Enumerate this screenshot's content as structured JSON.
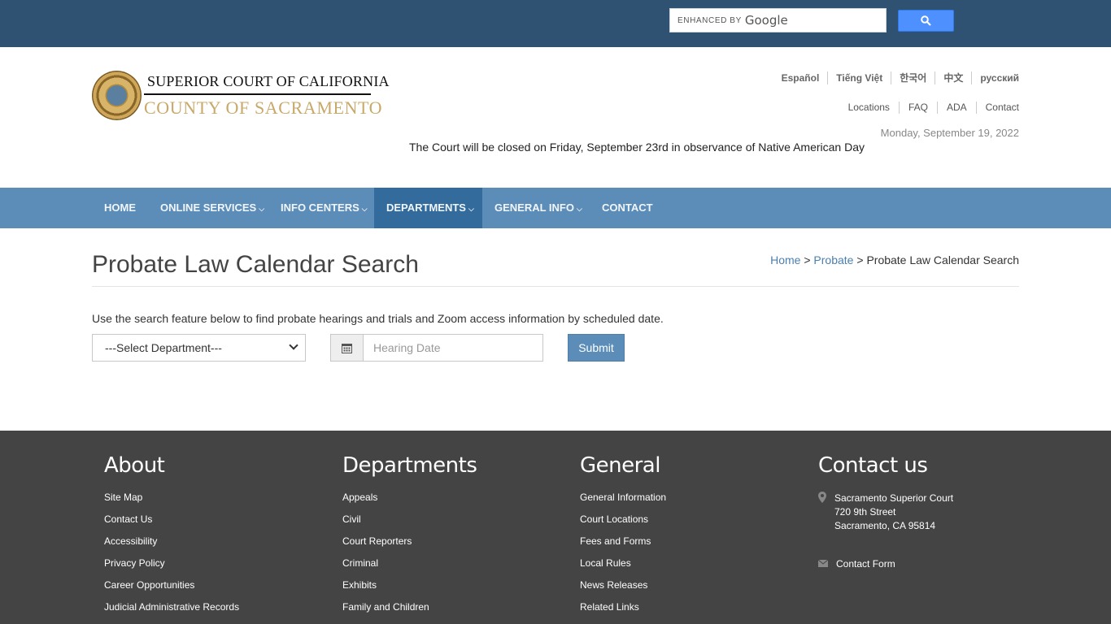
{
  "search": {
    "enhanced_label": "ENHANCED BY",
    "google_label": "Google"
  },
  "header": {
    "title_line1": "SUPERIOR COURT OF CALIFORNIA",
    "title_line2": "COUNTY OF SACRAMENTO",
    "languages": [
      "Español",
      "Tiếng Việt",
      "한국어",
      "中文",
      "русский"
    ],
    "links": [
      "Locations",
      "FAQ",
      "ADA",
      "Contact"
    ],
    "date": "Monday, September 19, 2022",
    "notice": "The Court will be closed on Friday, September 23rd in observance of Native American Day"
  },
  "nav": {
    "items": [
      {
        "label": "HOME"
      },
      {
        "label": "ONLINE SERVICES"
      },
      {
        "label": "INFO CENTERS"
      },
      {
        "label": "DEPARTMENTS",
        "active": true
      },
      {
        "label": "GENERAL INFO"
      },
      {
        "label": "CONTACT"
      }
    ]
  },
  "main": {
    "title": "Probate Law Calendar Search",
    "breadcrumb": {
      "home": "Home",
      "sep1": ">",
      "parent": "Probate",
      "sep2": ">",
      "current": "Probate Law Calendar Search"
    },
    "intro": "Use the search feature below to find probate hearings and trials and Zoom access information by scheduled date.",
    "department_select": "---Select Department---",
    "hearing_date_placeholder": "Hearing Date",
    "submit_label": "Submit"
  },
  "footer": {
    "about": {
      "title": "About",
      "items": [
        "Site Map",
        "Contact Us",
        "Accessibility",
        "Privacy Policy",
        "Career Opportunities",
        "Judicial Administrative Records"
      ]
    },
    "departments": {
      "title": "Departments",
      "items": [
        "Appeals",
        "Civil",
        "Court Reporters",
        "Criminal",
        "Exhibits",
        "Family and Children"
      ]
    },
    "general": {
      "title": "General",
      "items": [
        "General Information",
        "Court Locations",
        "Fees and Forms",
        "Local Rules",
        "News Releases",
        "Related Links"
      ]
    },
    "contact": {
      "title": "Contact us",
      "address": [
        "Sacramento Superior Court",
        "720 9th Street",
        "Sacramento, CA 95814"
      ],
      "form_label": "Contact Form"
    }
  },
  "colors": {
    "topbar": "#2f5172",
    "nav": "#5b8db8",
    "nav_active": "#326b9c",
    "footer": "#444444",
    "title_gold": "#c9a96a"
  }
}
